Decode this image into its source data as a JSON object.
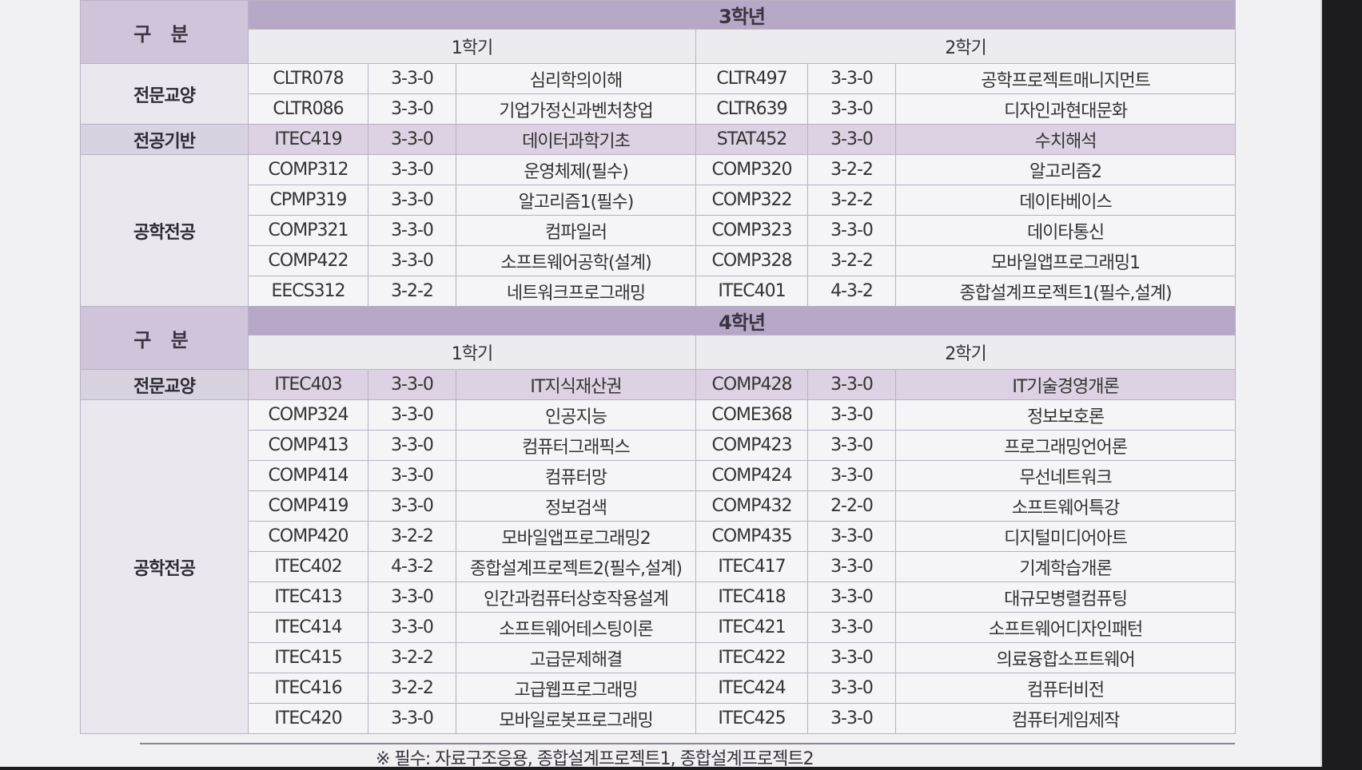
{
  "labels": {
    "gubun": "구 분",
    "sem1": "1학기",
    "sem2": "2학기"
  },
  "year3": {
    "title": "3학년",
    "groups": [
      {
        "category": "전문교양",
        "highlight": false,
        "rows": [
          {
            "c1": "CLTR078",
            "u1": "3-3-0",
            "n1": "심리학의이해",
            "c2": "CLTR497",
            "u2": "3-3-0",
            "n2": "공학프로젝트매니지먼트"
          },
          {
            "c1": "CLTR086",
            "u1": "3-3-0",
            "n1": "기업가정신과벤처창업",
            "c2": "CLTR639",
            "u2": "3-3-0",
            "n2": "디자인과현대문화"
          }
        ]
      },
      {
        "category": "전공기반",
        "highlight": true,
        "rows": [
          {
            "c1": "ITEC419",
            "u1": "3-3-0",
            "n1": "데이터과학기초",
            "c2": "STAT452",
            "u2": "3-3-0",
            "n2": "수치해석"
          }
        ]
      },
      {
        "category": "공학전공",
        "highlight": false,
        "rows": [
          {
            "c1": "COMP312",
            "u1": "3-3-0",
            "n1": "운영체제(필수)",
            "c2": "COMP320",
            "u2": "3-2-2",
            "n2": "알고리즘2"
          },
          {
            "c1": "CPMP319",
            "u1": "3-3-0",
            "n1": "알고리즘1(필수)",
            "c2": "COMP322",
            "u2": "3-2-2",
            "n2": "데이타베이스"
          },
          {
            "c1": "COMP321",
            "u1": "3-3-0",
            "n1": "컴파일러",
            "c2": "COMP323",
            "u2": "3-3-0",
            "n2": "데이타통신"
          },
          {
            "c1": "COMP422",
            "u1": "3-3-0",
            "n1": "소프트웨어공학(설계)",
            "c2": "COMP328",
            "u2": "3-2-2",
            "n2": "모바일앱프로그래밍1"
          },
          {
            "c1": "EECS312",
            "u1": "3-2-2",
            "n1": "네트워크프로그래밍",
            "c2": "ITEC401",
            "u2": "4-3-2",
            "n2": "종합설계프로젝트1(필수,설계)"
          }
        ]
      }
    ]
  },
  "year4": {
    "title": "4학년",
    "groups": [
      {
        "category": "전문교양",
        "highlight": true,
        "rows": [
          {
            "c1": "ITEC403",
            "u1": "3-3-0",
            "n1": "IT지식재산권",
            "c2": "COMP428",
            "u2": "3-3-0",
            "n2": "IT기술경영개론"
          }
        ]
      },
      {
        "category": "공학전공",
        "highlight": false,
        "rows": [
          {
            "c1": "COMP324",
            "u1": "3-3-0",
            "n1": "인공지능",
            "c2": "COME368",
            "u2": "3-3-0",
            "n2": "정보보호론"
          },
          {
            "c1": "COMP413",
            "u1": "3-3-0",
            "n1": "컴퓨터그래픽스",
            "c2": "COMP423",
            "u2": "3-3-0",
            "n2": "프로그래밍언어론"
          },
          {
            "c1": "COMP414",
            "u1": "3-3-0",
            "n1": "컴퓨터망",
            "c2": "COMP424",
            "u2": "3-3-0",
            "n2": "무선네트워크"
          },
          {
            "c1": "COMP419",
            "u1": "3-3-0",
            "n1": "정보검색",
            "c2": "COMP432",
            "u2": "2-2-0",
            "n2": "소프트웨어특강"
          },
          {
            "c1": "COMP420",
            "u1": "3-2-2",
            "n1": "모바일앱프로그래밍2",
            "c2": "COMP435",
            "u2": "3-3-0",
            "n2": "디지털미디어아트"
          },
          {
            "c1": "ITEC402",
            "u1": "4-3-2",
            "n1": "종합설계프로젝트2(필수,설계)",
            "c2": "ITEC417",
            "u2": "3-3-0",
            "n2": "기계학습개론"
          },
          {
            "c1": "ITEC413",
            "u1": "3-3-0",
            "n1": "인간과컴퓨터상호작용설계",
            "c2": "ITEC418",
            "u2": "3-3-0",
            "n2": "대규모병렬컴퓨팅"
          },
          {
            "c1": "ITEC414",
            "u1": "3-3-0",
            "n1": "소프트웨어테스팅이론",
            "c2": "ITEC421",
            "u2": "3-3-0",
            "n2": "소프트웨어디자인패턴"
          },
          {
            "c1": "ITEC415",
            "u1": "3-2-2",
            "n1": "고급문제해결",
            "c2": "ITEC422",
            "u2": "3-3-0",
            "n2": "의료융합소프트웨어"
          },
          {
            "c1": "ITEC416",
            "u1": "3-2-2",
            "n1": "고급웹프로그래밍",
            "c2": "ITEC424",
            "u2": "3-3-0",
            "n2": "컴퓨터비전"
          },
          {
            "c1": "ITEC420",
            "u1": "3-3-0",
            "n1": "모바일로봇프로그래밍",
            "c2": "ITEC425",
            "u2": "3-3-0",
            "n2": "컴퓨터게임제작"
          }
        ]
      }
    ]
  },
  "footer_note": "※ 필수: 자료구조응용, 종합설계프로젝트1, 종합설계프로젝트2"
}
